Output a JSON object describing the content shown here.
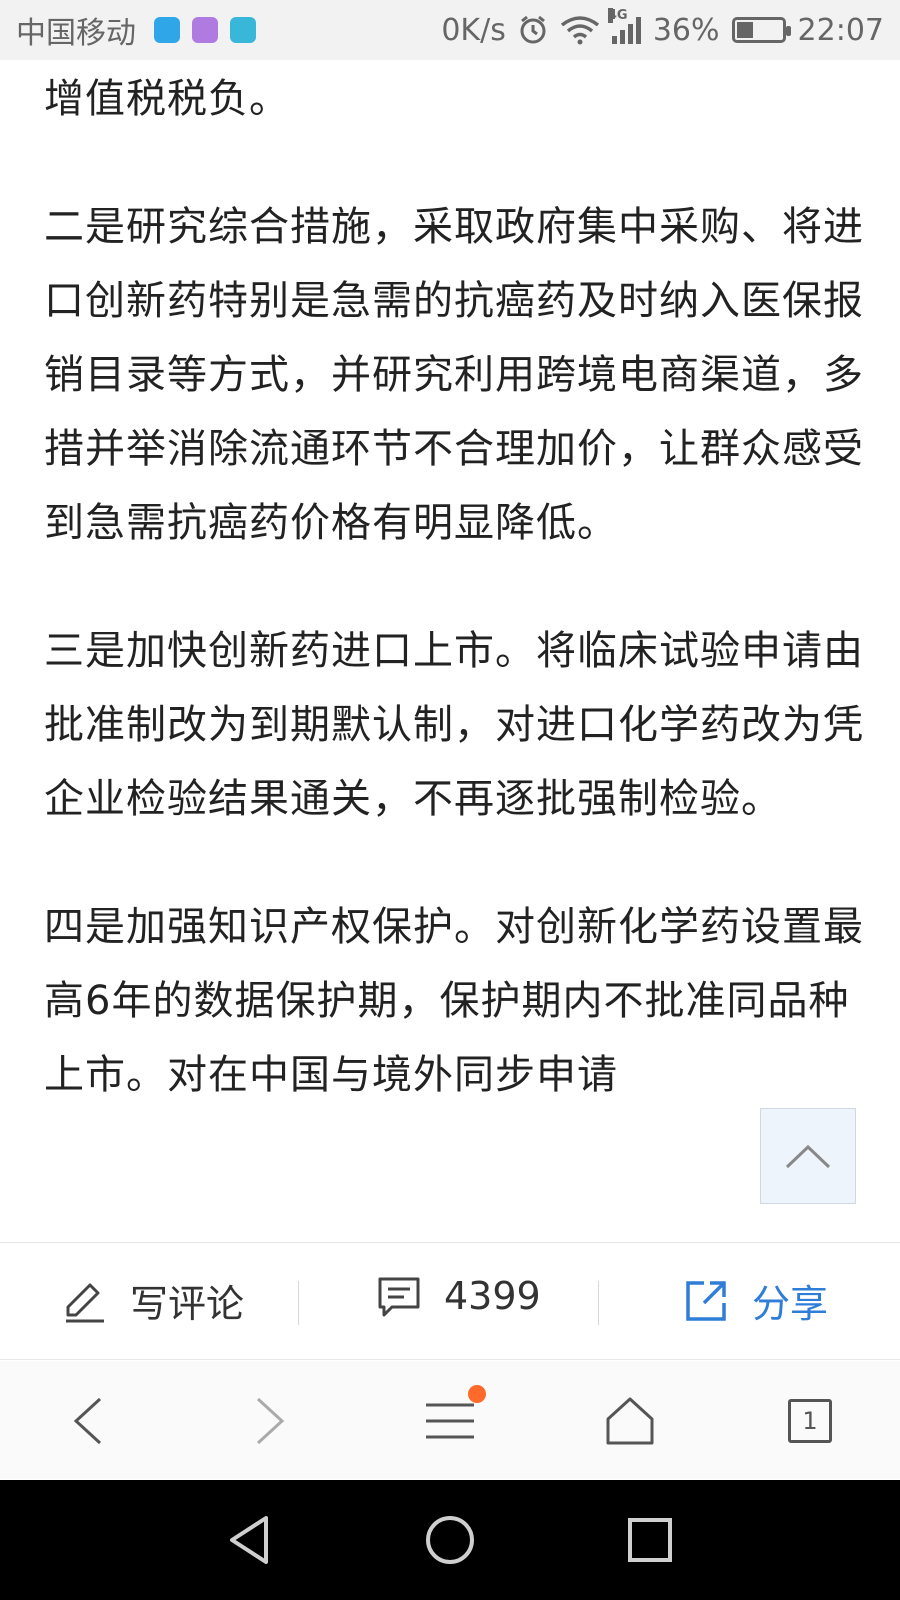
{
  "status_bar": {
    "carrier": "中国移动",
    "net_speed": "0K/s",
    "network_type": "4G",
    "battery_percent": "36%",
    "battery_level": 0.36,
    "time": "22:07",
    "icons": [
      "alarm-icon",
      "wifi-icon",
      "signal-icon",
      "battery-icon"
    ]
  },
  "article": {
    "paragraphs": [
      "增值税税负。",
      "二是研究综合措施，采取政府集中采购、将进口创新药特别是急需的抗癌药及时纳入医保报销目录等方式，并研究利用跨境电商渠道，多措并举消除流通环节不合理加价，让群众感受到急需抗癌药价格有明显降低。",
      "三是加快创新药进口上市。将临床试验申请由批准制改为到期默认制，对进口化学药改为凭企业检验结果通关，不再逐批强制检验。",
      "四是加强知识产权保护。对创新化学药设置最高6年的数据保护期，保护期内不批准同品种上市。对在中国与境外同步申请"
    ]
  },
  "action_bar": {
    "comment_label": "写评论",
    "comment_count": "4399",
    "share_label": "分享",
    "accent_color": "#2e7dd8"
  },
  "browser_nav": {
    "tab_count": "1",
    "notification_color": "#ff6a2a"
  }
}
